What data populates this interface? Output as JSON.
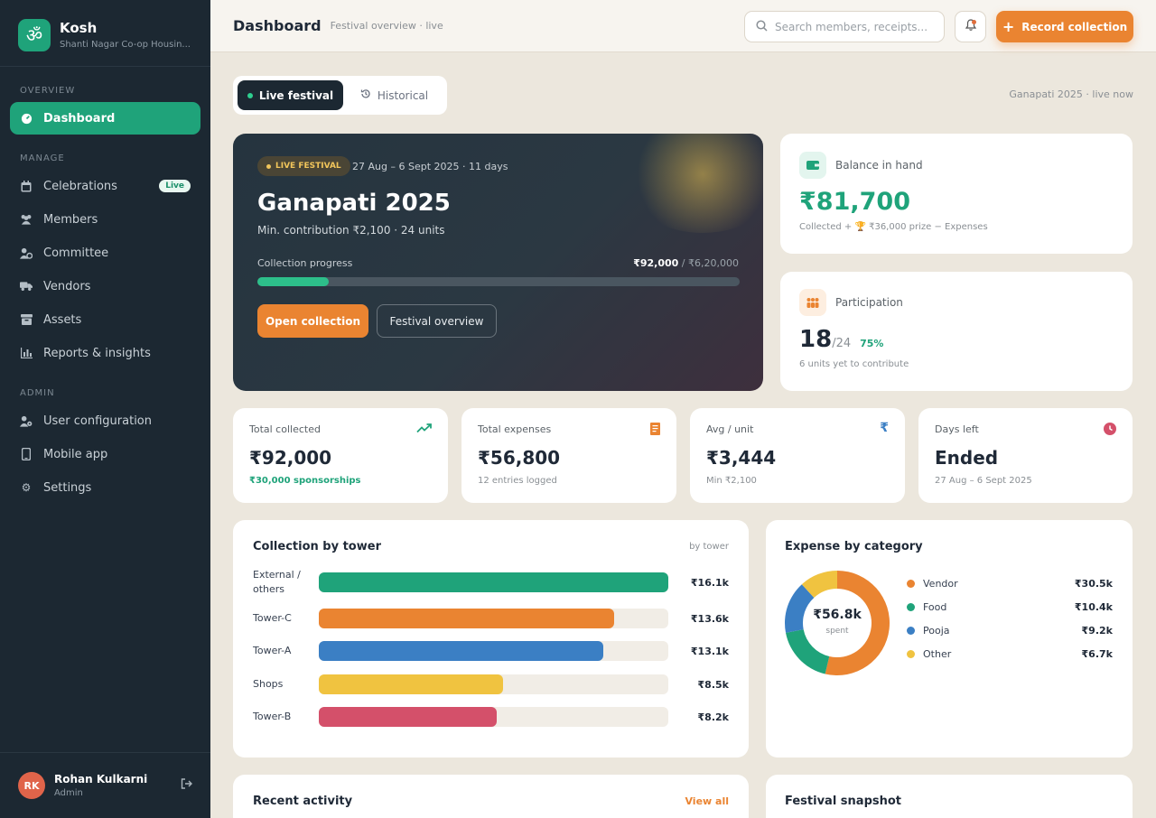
{
  "app": {
    "name": "Kosh",
    "society": "Shanti Nagar Co-op Housin...",
    "logo_glyph": "ॐ"
  },
  "sidebar": {
    "sections": {
      "overview": "OVERVIEW",
      "manage": "MANAGE",
      "admin": "ADMIN"
    },
    "items": [
      {
        "label": "Dashboard",
        "icon": "gauge-icon"
      },
      {
        "label": "Celebrations",
        "icon": "calendar-icon",
        "badge": "Live"
      },
      {
        "label": "Members",
        "icon": "users-icon"
      },
      {
        "label": "Committee",
        "icon": "user-gear-icon"
      },
      {
        "label": "Vendors",
        "icon": "truck-icon"
      },
      {
        "label": "Assets",
        "icon": "archive-icon"
      },
      {
        "label": "Reports & insights",
        "icon": "bar-chart-icon"
      },
      {
        "label": "User configuration",
        "icon": "user-cog-icon"
      },
      {
        "label": "Mobile app",
        "icon": "mobile-icon"
      },
      {
        "label": "Settings",
        "icon": "gear-icon"
      }
    ],
    "user": {
      "initials": "RK",
      "name": "Rohan Kulkarni",
      "role": "Admin"
    }
  },
  "header": {
    "title": "Dashboard",
    "subtitle": "Festival overview · live",
    "search_placeholder": "Search members, receipts...",
    "record_label": "Record collection"
  },
  "toggle": {
    "live": "Live festival",
    "historical": "Historical",
    "status": "Ganapati 2025 · live now"
  },
  "hero": {
    "badge": "LIVE FESTIVAL",
    "dates": "27 Aug – 6 Sept 2025 · 11 days",
    "title": "Ganapati 2025",
    "min": "Min. contribution ₹2,100 · 24 units",
    "progress_label": "Collection progress",
    "collected": "₹92,000",
    "target": " / ₹6,20,000",
    "progress_fraction": 0.148,
    "open_label": "Open collection",
    "overview_label": "Festival overview"
  },
  "balance": {
    "title": "Balance in hand",
    "value": "₹81,700",
    "note": "Collected + 🏆 ₹36,000 prize − Expenses"
  },
  "participation": {
    "title": "Participation",
    "count": "18",
    "total": "/24",
    "pct": "75%",
    "note": "6 units yet to contribute"
  },
  "stats": [
    {
      "title": "Total collected",
      "value": "₹92,000",
      "sub": "₹30,000 sponsorships",
      "icon": "trend-up-icon"
    },
    {
      "title": "Total expenses",
      "value": "₹56,800",
      "sub": "12 entries logged",
      "icon": "receipt-icon"
    },
    {
      "title": "Avg / unit",
      "value": "₹3,444",
      "sub": "Min ₹2,100",
      "icon": "rupee-icon"
    },
    {
      "title": "Days left",
      "value": "Ended",
      "sub": "27 Aug – 6 Sept 2025",
      "icon": "clock-icon"
    }
  ],
  "tower_chart": {
    "title": "Collection by tower",
    "tag": "by tower",
    "chart_data": {
      "type": "bar",
      "categories": [
        "External / others",
        "Tower-C",
        "Tower-A",
        "Shops",
        "Tower-B"
      ],
      "values": [
        16.1,
        13.6,
        13.1,
        8.5,
        8.2
      ],
      "labels": [
        "₹16.1k",
        "₹13.6k",
        "₹13.1k",
        "₹8.5k",
        "₹8.2k"
      ],
      "colors": [
        "#1fa37a",
        "#ea8431",
        "#3b7fc4",
        "#f0c340",
        "#d4506a"
      ],
      "unit": "₹k"
    }
  },
  "expense_chart": {
    "title": "Expense by category",
    "center_value": "₹56.8k",
    "center_label": "spent",
    "chart_data": {
      "type": "pie",
      "categories": [
        "Vendor",
        "Food",
        "Pooja",
        "Other"
      ],
      "values": [
        30.5,
        10.4,
        9.2,
        6.7
      ],
      "labels": [
        "₹30.5k",
        "₹10.4k",
        "₹9.2k",
        "₹6.7k"
      ],
      "colors": [
        "#ea8431",
        "#1fa37a",
        "#3b7fc4",
        "#f0c340"
      ]
    }
  },
  "recent": {
    "title": "Recent activity",
    "link": "View all"
  },
  "snapshot": {
    "title": "Festival snapshot"
  }
}
